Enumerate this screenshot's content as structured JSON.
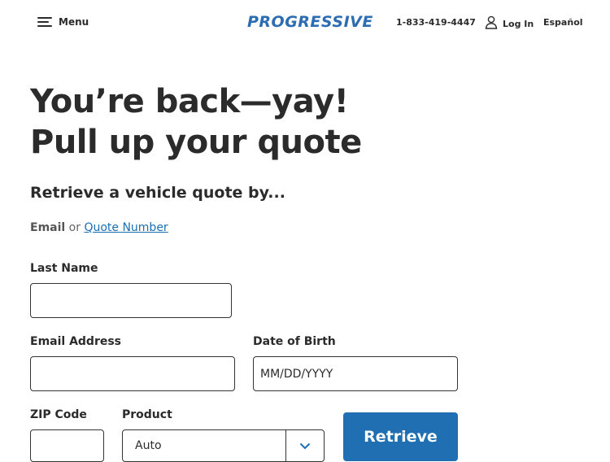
{
  "header": {
    "menu_label": "Menu",
    "logo_text": "PROGRESSIVE",
    "phone": "1-833-419-4447",
    "login_label": "Log In",
    "language_label": "Español"
  },
  "hero": {
    "headline_line1": "You’re back—yay!",
    "headline_line2": "Pull up your quote",
    "subhead": "Retrieve a vehicle quote by..."
  },
  "retrieve_by": {
    "email": "Email",
    "or": "or",
    "quote_number_link": "Quote Number"
  },
  "form": {
    "last_name_label": "Last Name",
    "last_name_value": "",
    "email_label": "Email Address",
    "email_value": "",
    "dob_label": "Date of Birth",
    "dob_placeholder": "MM/DD/YYYY",
    "zip_label": "ZIP Code",
    "zip_value": "",
    "product_label": "Product",
    "product_value": "Auto",
    "retrieve_button": "Retrieve"
  },
  "colors": {
    "brand_blue": "#2b6cb3",
    "button_blue": "#1f6fb2",
    "link_blue": "#1b6fb3",
    "text_dark": "#2b2b2b"
  }
}
